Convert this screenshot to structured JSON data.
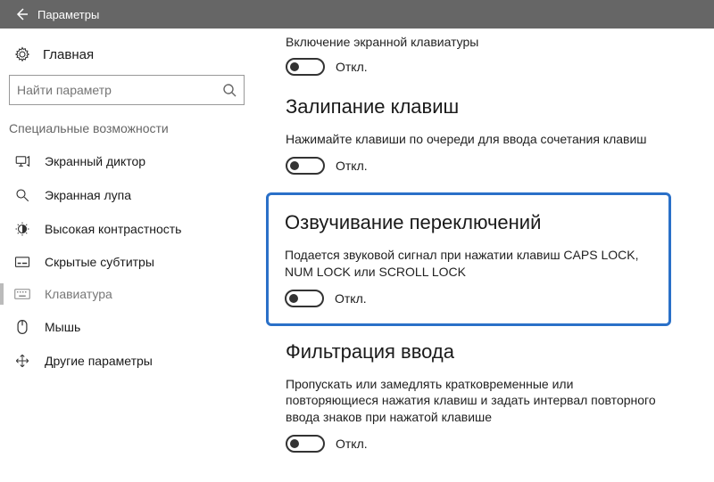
{
  "window": {
    "title": "Параметры"
  },
  "sidebar": {
    "home_label": "Главная",
    "search_placeholder": "Найти параметр",
    "category_label": "Специальные возможности",
    "items": [
      {
        "label": "Экранный диктор"
      },
      {
        "label": "Экранная лупа"
      },
      {
        "label": "Высокая контрастность"
      },
      {
        "label": "Скрытые субтитры"
      },
      {
        "label": "Клавиатура"
      },
      {
        "label": "Мышь"
      },
      {
        "label": "Другие параметры"
      }
    ]
  },
  "content": {
    "sections": [
      {
        "title": "Включение экранной клавиатуры",
        "description": "",
        "toggle_state": "Откл."
      },
      {
        "title": "Залипание клавиш",
        "description": "Нажимайте клавиши по очереди для ввода сочетания клавиш",
        "toggle_state": "Откл."
      },
      {
        "title": "Озвучивание переключений",
        "description": "Подается звуковой сигнал при нажатии клавиш CAPS LOCK, NUM LOCK или SCROLL LOCK",
        "toggle_state": "Откл."
      },
      {
        "title": "Фильтрация ввода",
        "description": "Пропускать или замедлять кратковременные или повторяющиеся нажатия клавиш и задать интервал повторного ввода знаков при нажатой клавише",
        "toggle_state": "Откл."
      }
    ]
  }
}
